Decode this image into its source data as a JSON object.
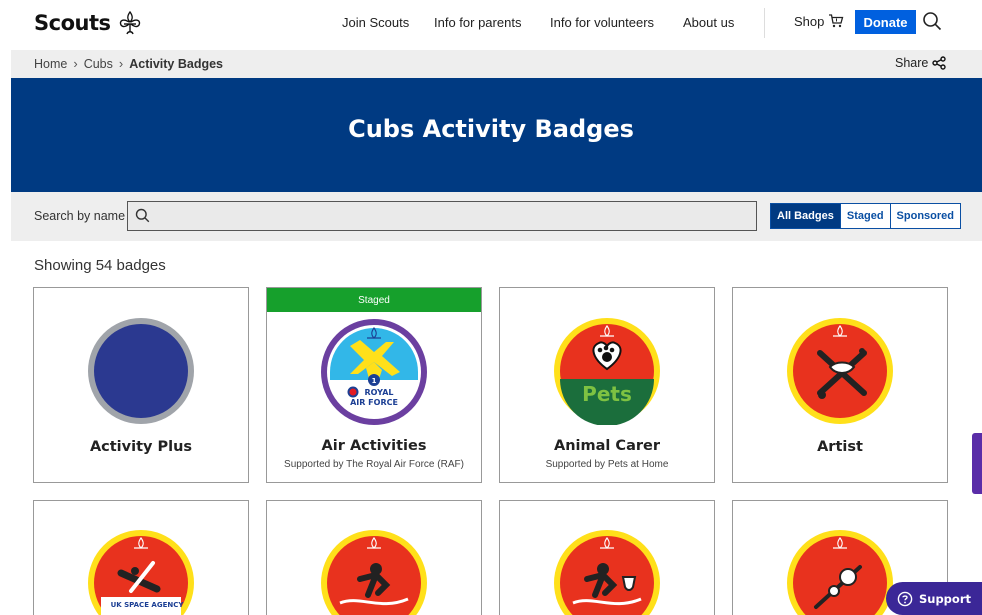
{
  "header": {
    "logo_text": "Scouts",
    "nav": [
      "Join Scouts",
      "Info for parents",
      "Info for volunteers",
      "About us"
    ],
    "shop_label": "Shop",
    "donate_label": "Donate"
  },
  "breadcrumb": {
    "items": [
      "Home",
      "Cubs",
      "Activity Badges"
    ],
    "share_label": "Share"
  },
  "hero": {
    "title": "Cubs Activity Badges"
  },
  "filter": {
    "search_label": "Search by name",
    "search_value": "",
    "tabs": [
      "All Badges",
      "Staged",
      "Sponsored"
    ],
    "active_tab": "All Badges"
  },
  "results": {
    "count_text": "Showing 54 badges",
    "badges": [
      {
        "name": "Activity Plus",
        "subtitle": "",
        "staged": false
      },
      {
        "name": "Air Activities",
        "subtitle": "Supported by The Royal Air Force (RAF)",
        "staged": true,
        "staged_label": "Staged",
        "logo_text_1": "ROYAL",
        "logo_text_2": "AIR FORCE"
      },
      {
        "name": "Animal Carer",
        "subtitle": "Supported by Pets at Home",
        "staged": false,
        "logo_text": "Pets"
      },
      {
        "name": "Artist",
        "subtitle": "",
        "staged": false
      },
      {
        "name": "",
        "subtitle": "",
        "staged": false,
        "logo_text": "UK SPACE AGENCY"
      },
      {
        "name": "",
        "subtitle": "",
        "staged": false
      },
      {
        "name": "",
        "subtitle": "",
        "staged": false
      },
      {
        "name": "",
        "subtitle": "",
        "staged": false
      }
    ]
  },
  "support": {
    "label": "Support"
  },
  "colors": {
    "navy": "#003a82",
    "donate_blue": "#0060df",
    "staged_green": "#16a02c",
    "badge_red": "#e8321e",
    "badge_yellow": "#ffe01a",
    "support_purple": "#3b2797"
  }
}
